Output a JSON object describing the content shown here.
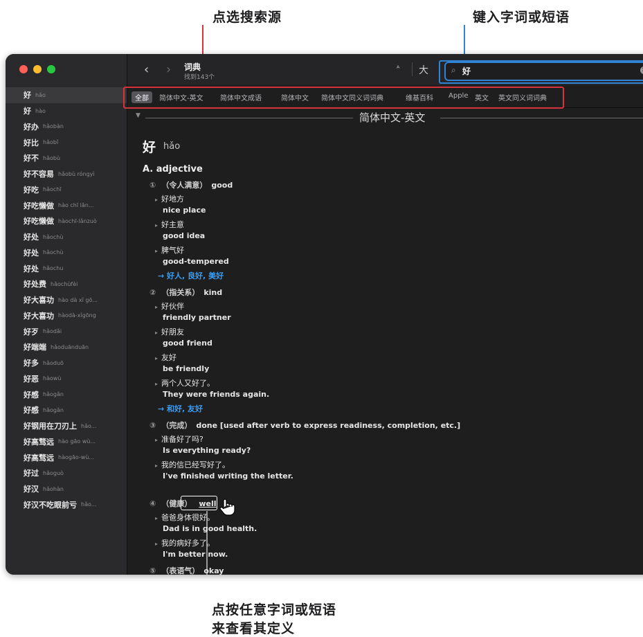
{
  "callouts": {
    "sources": "点选搜索源",
    "type": "键入字词或短语",
    "click_line1": "点按任意字词或短语",
    "click_line2": "来查看其定义"
  },
  "colors": {
    "callout_red": "#d8323c",
    "callout_blue": "#2f84d6",
    "link_blue": "#3b9cf4"
  },
  "toolbar": {
    "back": "‹",
    "forward": "›",
    "title": "词典",
    "subtitle": "找到143个",
    "font_small": "ᴬ",
    "font_large": "大",
    "search_value": "好"
  },
  "sidebar": {
    "items": [
      {
        "word": "好",
        "pinyin": "hǎo"
      },
      {
        "word": "好",
        "pinyin": "hào"
      },
      {
        "word": "好办",
        "pinyin": "hǎobàn"
      },
      {
        "word": "好比",
        "pinyin": "hǎobǐ"
      },
      {
        "word": "好不",
        "pinyin": "hǎobù"
      },
      {
        "word": "好不容易",
        "pinyin": "hǎobù róngyì"
      },
      {
        "word": "好吃",
        "pinyin": "hǎochī"
      },
      {
        "word": "好吃懒做",
        "pinyin": "hào chī lǎn..."
      },
      {
        "word": "好吃懒做",
        "pinyin": "hàochī-lǎnzuò"
      },
      {
        "word": "好处",
        "pinyin": "hǎochù"
      },
      {
        "word": "好处",
        "pinyin": "hǎochù"
      },
      {
        "word": "好处",
        "pinyin": "hǎochu"
      },
      {
        "word": "好处费",
        "pinyin": "hǎochùfèi"
      },
      {
        "word": "好大喜功",
        "pinyin": "hào dà xǐ gō..."
      },
      {
        "word": "好大喜功",
        "pinyin": "hàodà-xǐgōng"
      },
      {
        "word": "好歹",
        "pinyin": "hǎodǎi"
      },
      {
        "word": "好端端",
        "pinyin": "hǎoduānduān"
      },
      {
        "word": "好多",
        "pinyin": "hǎoduō"
      },
      {
        "word": "好恶",
        "pinyin": "hàowù"
      },
      {
        "word": "好感",
        "pinyin": "hǎogǎn"
      },
      {
        "word": "好感",
        "pinyin": "hǎogǎn"
      },
      {
        "word": "好钢用在刀刃上",
        "pinyin": "hǎo..."
      },
      {
        "word": "好高骛远",
        "pinyin": "hào gāo wù..."
      },
      {
        "word": "好高骛远",
        "pinyin": "hàogāo-wù..."
      },
      {
        "word": "好过",
        "pinyin": "hǎoguò"
      },
      {
        "word": "好汉",
        "pinyin": "hǎohàn"
      },
      {
        "word": "好汉不吃眼前亏",
        "pinyin": "hǎo..."
      }
    ]
  },
  "sources": {
    "tabs": [
      "全部",
      "简体中文-英文",
      "简体中文成语",
      "简体中文",
      "简体中文同义词词典",
      "维基百科",
      "Apple",
      "英文",
      "英文同义词词典"
    ]
  },
  "entry": {
    "section_title": "简体中文-英文",
    "headword": "好",
    "pinyin": "hǎo",
    "pos": "A. adjective",
    "s1_num": "①",
    "s1_cn": "（令人满意）",
    "s1_en": "good",
    "s1_ex1_cn": "好地方",
    "s1_ex1_en": "nice place",
    "s1_ex2_cn": "好主意",
    "s1_ex2_en": "good idea",
    "s1_ex3_cn": "脾气好",
    "s1_ex3_en": "good-tempered",
    "s1_xref": "→ 好人, 良好, 美好",
    "s2_num": "②",
    "s2_cn": "（指关系）",
    "s2_en": "kind",
    "s2_ex1_cn": "好伙伴",
    "s2_ex1_en": "friendly partner",
    "s2_ex2_cn": "好朋友",
    "s2_ex2_en": "good friend",
    "s2_ex3_cn": "友好",
    "s2_ex3_en": "be friendly",
    "s2_ex4_cn": "两个人又好了。",
    "s2_ex4_en": "They were friends again.",
    "s2_xref": "→ 和好, 友好",
    "s3_num": "③",
    "s3_cn": "（完成）",
    "s3_en": "done [used after verb to express readiness, completion, etc.]",
    "s3_ex1_cn": "准备好了吗?",
    "s3_ex1_en": "Is everything ready?",
    "s3_ex2_cn": "我的信已经写好了。",
    "s3_ex2_en": "I've finished writing the letter.",
    "s4_num": "④",
    "s4_cn": "（健康）",
    "s4_en": "well",
    "s4_ex1_cn": "爸爸身体很好。",
    "s4_ex1_en": "Dad is in good health.",
    "s4_ex2_cn": "我的病好多了。",
    "s4_ex2_en": "I'm better now.",
    "s5_num": "⑤",
    "s5_cn": "（表语气）",
    "s5_en": "okay"
  }
}
